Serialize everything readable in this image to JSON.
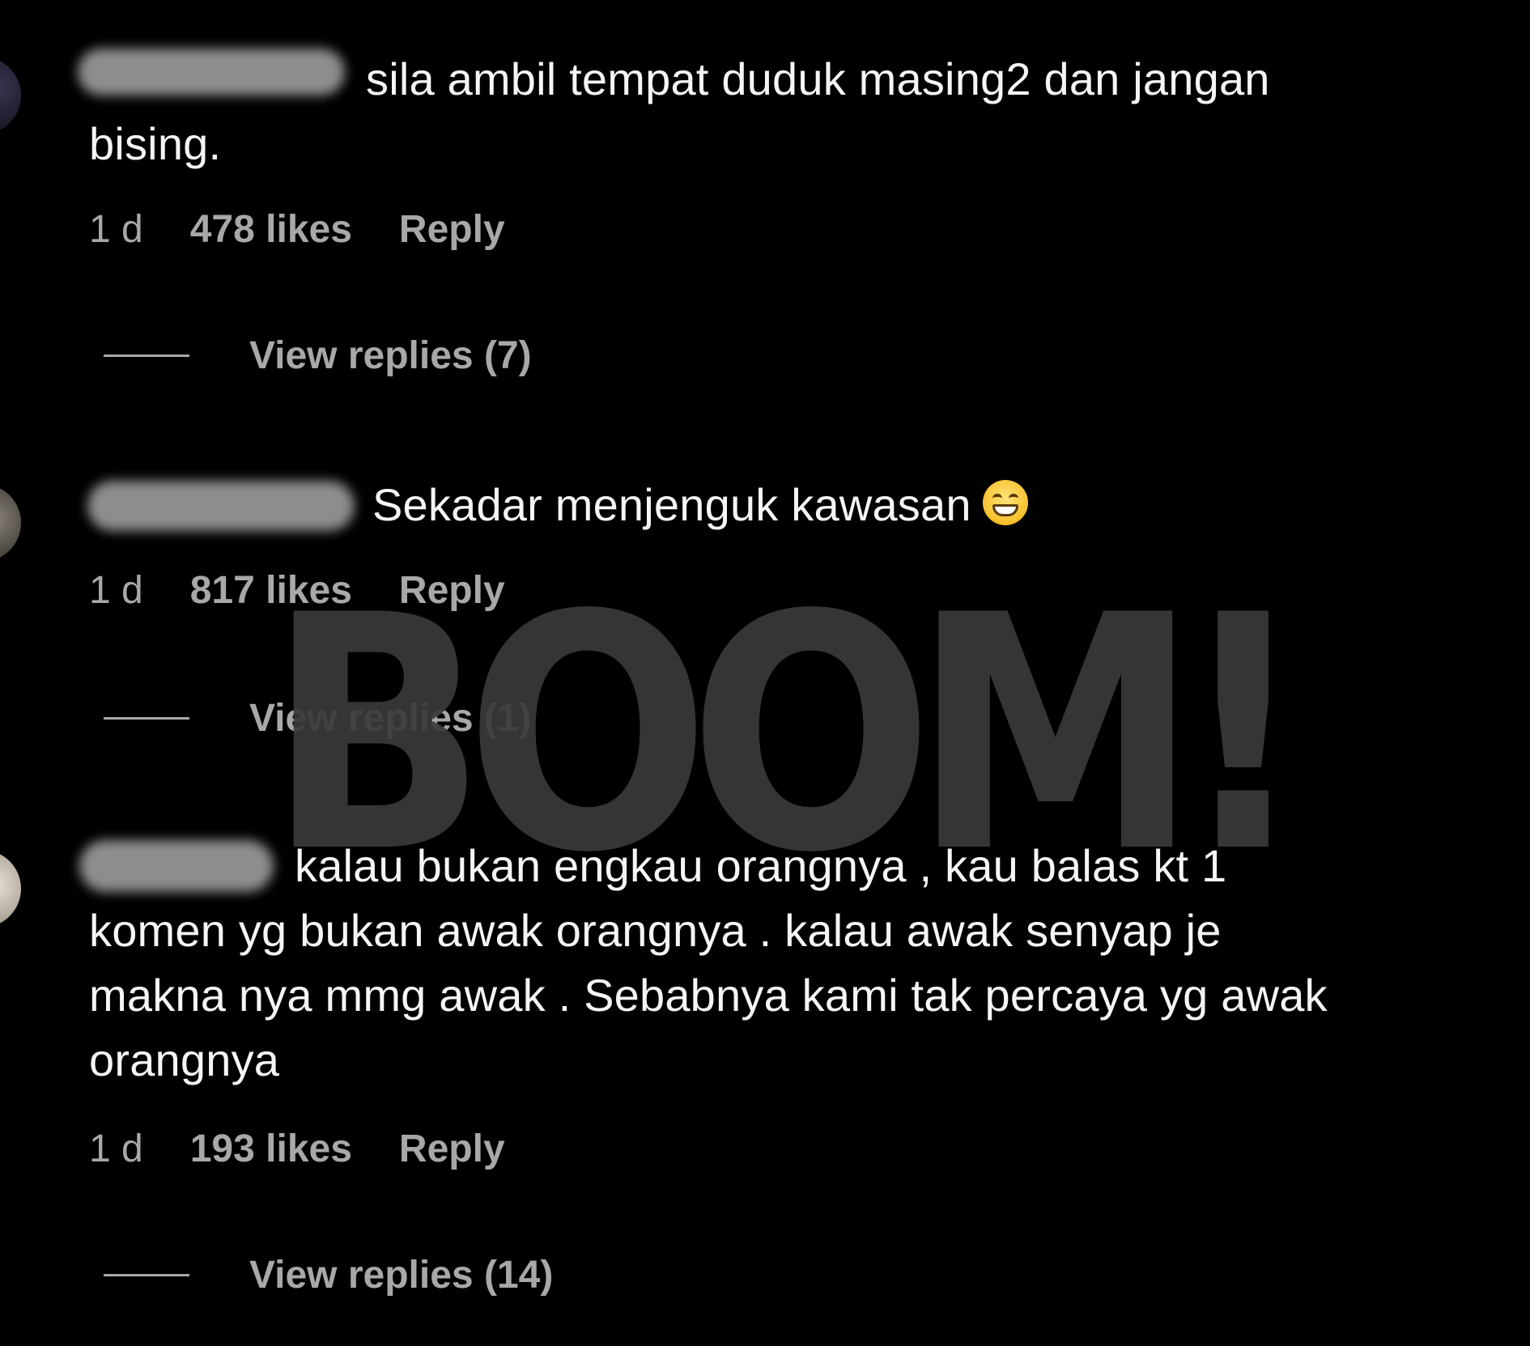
{
  "comments": [
    {
      "text_lines": [
        "sila ambil tempat duduk masing2 dan jangan",
        "bising."
      ],
      "time": "1 d",
      "likes": "478 likes",
      "reply_label": "Reply",
      "view_replies": "View replies (7)"
    },
    {
      "text_lines": [
        "Sekadar menjenguk kawasan"
      ],
      "emoji": "grinning-face-icon",
      "time": "1 d",
      "likes": "817 likes",
      "reply_label": "Reply",
      "view_replies": "View replies (1)"
    },
    {
      "text_lines": [
        "kalau bukan engkau orangnya , kau balas kt 1",
        "komen yg bukan awak orangnya . kalau awak senyap je",
        "makna nya mmg awak . Sebabnya kami tak percaya yg awak",
        "orangnya"
      ],
      "time": "1 d",
      "likes": "193 likes",
      "reply_label": "Reply",
      "view_replies": "View replies (14)"
    }
  ],
  "watermark": {
    "text": "BOOM!",
    "color": "#3a3a3a"
  },
  "colors": {
    "background": "#000000",
    "primary_text": "#f5f5f5",
    "secondary_text": "#a8a8a8"
  }
}
